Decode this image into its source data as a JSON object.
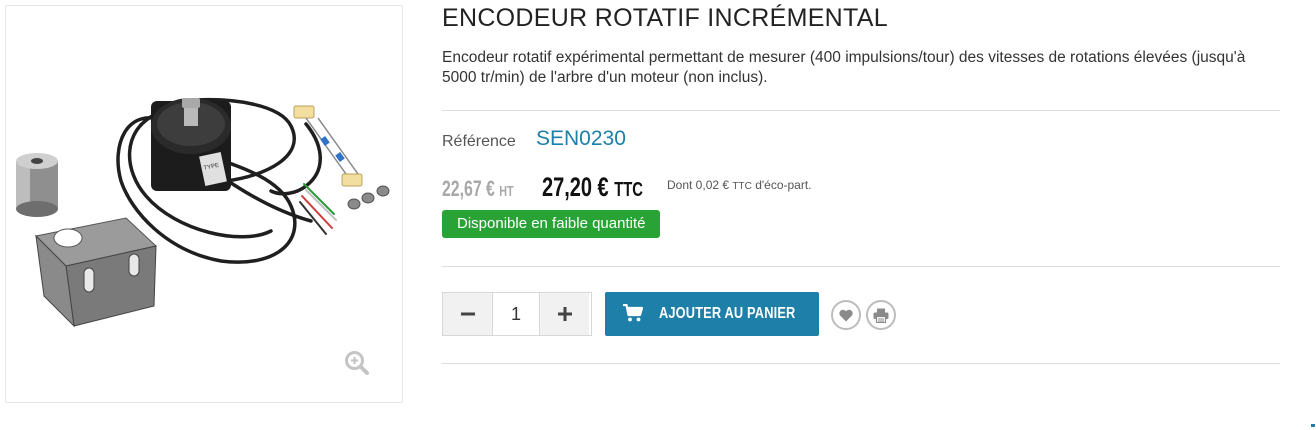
{
  "product": {
    "title": "ENCODEUR ROTATIF INCRÉMENTAL",
    "description": "Encodeur rotatif expérimental permettant de mesurer (400 impulsions/tour) des vitesses de rotations élevées (jusqu'à 5000 tr/min) de l'arbre d'un moteur (non inclus).",
    "reference_label": "Référence",
    "reference_value": "SEN0230",
    "price_ht": "22,67 €",
    "price_ht_suffix": "HT",
    "price_ttc": "27,20 €",
    "price_ttc_suffix": "TTC",
    "eco_prefix": "Dont 0,02 €",
    "eco_ttc": "TTC",
    "eco_suffix": "d'éco-part.",
    "availability": "Disponible en faible quantité"
  },
  "purchase": {
    "quantity": "1",
    "add_to_cart_label": "AJOUTER AU PANIER"
  },
  "icons": {
    "zoom": "zoom-in-icon",
    "cart": "shopping-cart-icon",
    "wishlist": "heart-icon",
    "print": "printer-icon",
    "decrement": "minus-icon",
    "increment": "plus-icon"
  },
  "colors": {
    "accent": "#1e7fa8",
    "availability": "#2aa336",
    "price_old": "#a8a8a8"
  }
}
